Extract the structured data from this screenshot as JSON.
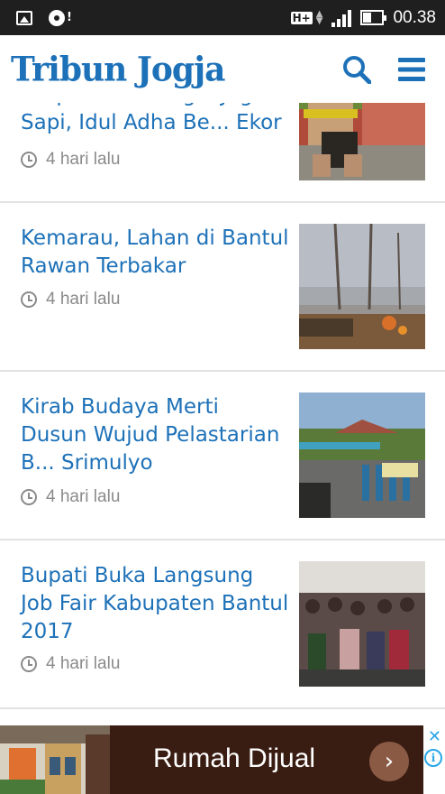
{
  "status_bar": {
    "network": "H+",
    "time": "00.38"
  },
  "header": {
    "logo_text": "Tribun Jogja"
  },
  "articles": [
    {
      "title": "Berprofesi sebagai Jagal Sapi, Idul Adha Be... Ekor",
      "time": "4 hari lalu",
      "thumb": "man-sitting-photo"
    },
    {
      "title": "Kemarau, Lahan di Bantul Rawan Terbakar",
      "time": "4 hari lalu",
      "thumb": "burning-field-photo"
    },
    {
      "title": "Kirab Budaya Merti Dusun Wujud Pelastarian B... Srimulyo",
      "time": "4 hari lalu",
      "thumb": "parade-photo"
    },
    {
      "title": "Bupati Buka Langsung Job Fair Kabupaten Bantul 2017",
      "time": "4 hari lalu",
      "thumb": "crowd-photo"
    }
  ],
  "ad": {
    "text": "Rumah Dijual",
    "go_symbol": "›",
    "close_symbol": "✕",
    "info_symbol": "i"
  },
  "colors": {
    "brand_blue": "#1d71b8",
    "status_bar": "#1f1f1f",
    "meta_gray": "#8a8a8a",
    "ad_bg": "#3a1d12"
  }
}
